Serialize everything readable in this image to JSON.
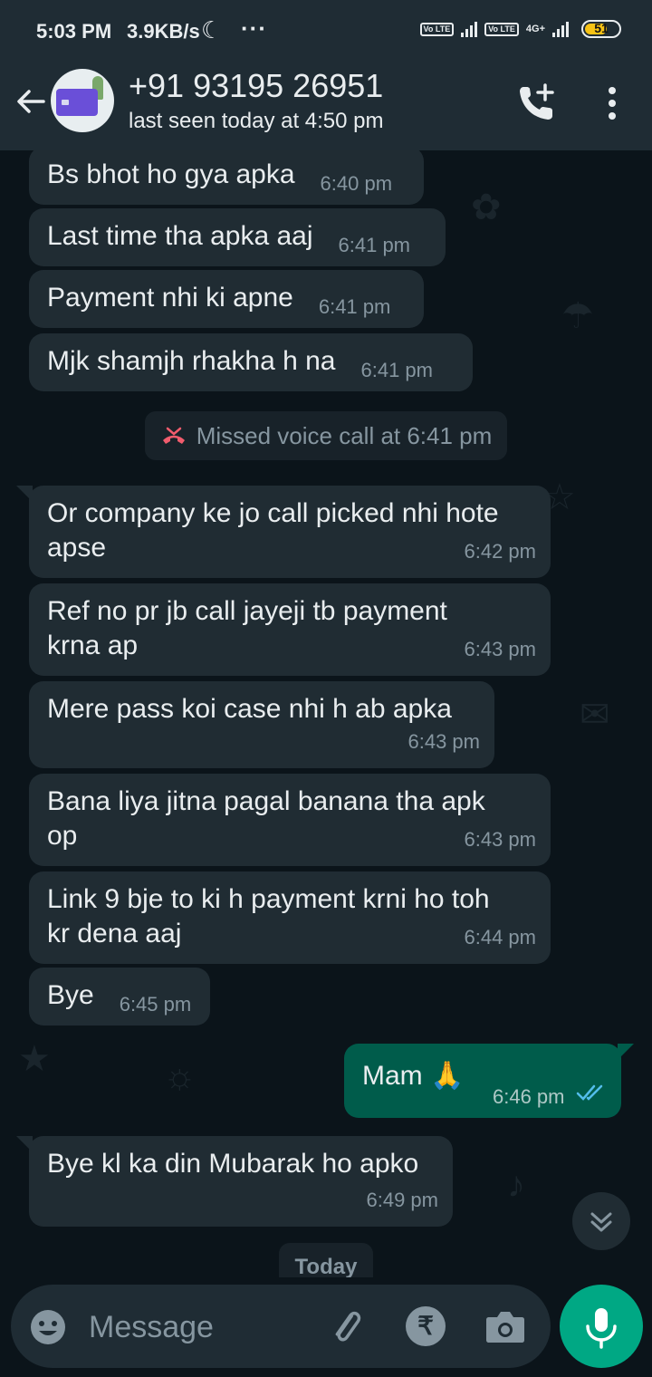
{
  "status_bar": {
    "time": "5:03 PM",
    "speed": "3.9KB/s",
    "moon": "☾",
    "dots": "···",
    "volte1": "Vo LTE",
    "volte2": "Vo LTE",
    "net": "4G+",
    "battery": "51"
  },
  "header": {
    "name": "+91 93195 26951",
    "status": "last seen today at 4:50 pm"
  },
  "messages": [
    {
      "text": "Bs bhot ho gya apka",
      "time": "6:40 pm"
    },
    {
      "text": "Last time tha apka aaj",
      "time": "6:41 pm"
    },
    {
      "text": "Payment nhi ki apne",
      "time": "6:41 pm"
    },
    {
      "text": "Mjk shamjh rhakha h na",
      "time": "6:41 pm"
    },
    {
      "text": "Or company ke jo call picked nhi hote\napse",
      "time": "6:42 pm"
    },
    {
      "text": "Ref no pr jb call jayeji tb payment\nkrna ap",
      "time": "6:43 pm"
    },
    {
      "text": "Mere pass koi case nhi h ab apka",
      "time": "6:43 pm"
    },
    {
      "text": "Bana liya jitna pagal banana tha apk\nop",
      "time": "6:43 pm"
    },
    {
      "text": "Link 9 bje to ki h payment krni ho toh\nkr dena aaj",
      "time": "6:44 pm"
    },
    {
      "text": "Bye",
      "time": "6:45 pm"
    },
    {
      "text": "Bye kl ka din Mubarak ho apko",
      "time": "6:49 pm"
    }
  ],
  "missed_call": "Missed voice call at 6:41 pm",
  "sent": {
    "text": "Mam 🙏",
    "time": "6:46 pm"
  },
  "date_chip": "Today",
  "composer": {
    "placeholder": "Message",
    "rupee": "₹"
  },
  "colors": {
    "accent": "#00a884",
    "sent_bubble": "#005c4b",
    "incoming_bubble": "#202c33",
    "missed_call": "#f15c6d",
    "read_ticks": "#53bdeb"
  }
}
